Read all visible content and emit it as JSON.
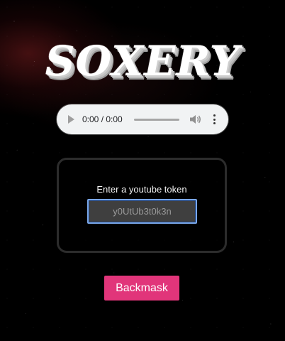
{
  "title": "SOXERY",
  "audio_player": {
    "time": "0:00 / 0:00",
    "progress": 0
  },
  "token_panel": {
    "label": "Enter a youtube token",
    "input_placeholder": "y0UtUb3t0k3n",
    "input_value": ""
  },
  "backmask_button": {
    "label": "Backmask"
  },
  "colors": {
    "background": "#000000",
    "accent_pink": "#e1357a",
    "input_focus": "#7aa7e8"
  }
}
